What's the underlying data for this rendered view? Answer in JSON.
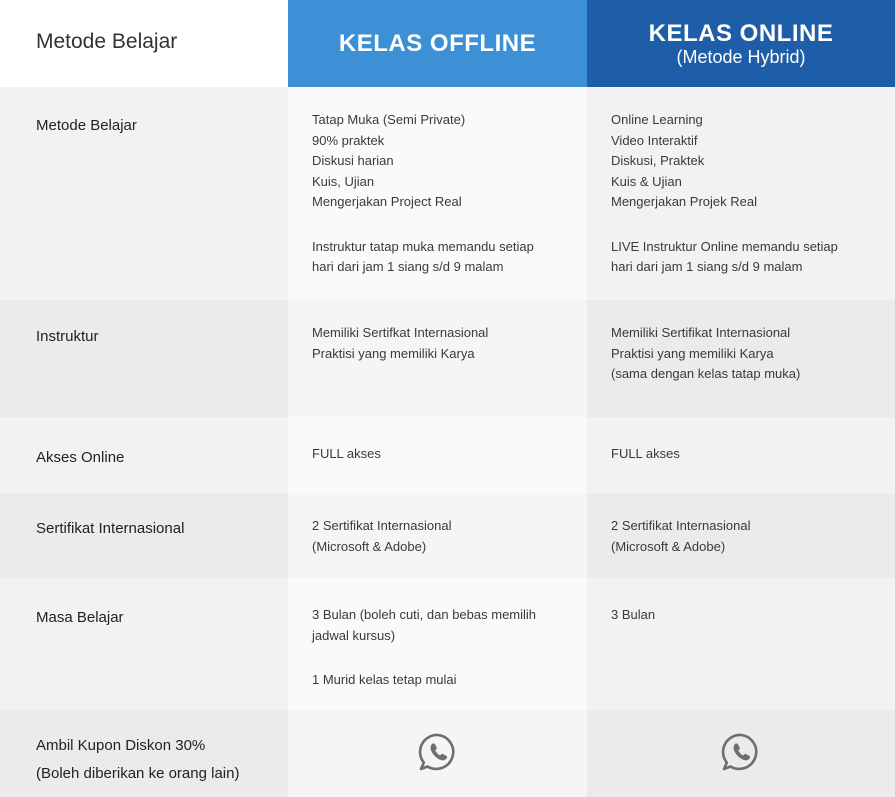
{
  "header": {
    "label": "Metode Belajar",
    "offline_title": "KELAS OFFLINE",
    "online_title": "KELAS ONLINE",
    "online_subtitle": "(Metode Hybrid)"
  },
  "rows": [
    {
      "label": "Metode Belajar",
      "offline": [
        "Tatap Muka (Semi Private)",
        "90% praktek",
        "Diskusi harian",
        "Kuis, Ujian",
        "Mengerjakan Project Real",
        "",
        "Instruktur tatap muka memandu setiap",
        "hari dari jam 1 siang s/d 9 malam"
      ],
      "online": [
        "Online Learning",
        "Video Interaktif",
        "Diskusi, Praktek",
        "Kuis & Ujian",
        "Mengerjakan Projek Real",
        "",
        "LIVE Instruktur Online memandu setiap",
        "hari dari jam 1 siang s/d 9 malam"
      ]
    },
    {
      "label": "Instruktur",
      "offline": [
        "Memiliki Sertifkat Internasional",
        "Praktisi yang memiliki Karya"
      ],
      "online": [
        "Memiliki Sertifikat Internasional",
        "Praktisi yang memiliki Karya",
        "(sama dengan kelas tatap muka)"
      ]
    },
    {
      "label": "Akses Online",
      "offline": [
        "FULL akses"
      ],
      "online": [
        "FULL akses"
      ]
    },
    {
      "label": "Sertifikat Internasional",
      "offline": [
        "2 Sertifikat Internasional",
        "(Microsoft & Adobe)"
      ],
      "online": [
        "2 Sertifikat Internasional",
        "(Microsoft & Adobe)"
      ]
    },
    {
      "label": "Masa Belajar",
      "offline": [
        "3 Bulan (boleh cuti, dan bebas memilih",
        "jadwal kursus)",
        "",
        "1 Murid kelas tetap mulai"
      ],
      "online": [
        "3 Bulan"
      ]
    },
    {
      "label": "Ambil Kupon Diskon 30%",
      "sublabel": "(Boleh diberikan ke orang lain)",
      "offline_icon": "whatsapp-icon",
      "online_icon": "whatsapp-icon"
    }
  ],
  "colors": {
    "offline_header": "#3d8fd6",
    "online_header": "#1e5ea8",
    "icon": "#6e6e6e"
  }
}
